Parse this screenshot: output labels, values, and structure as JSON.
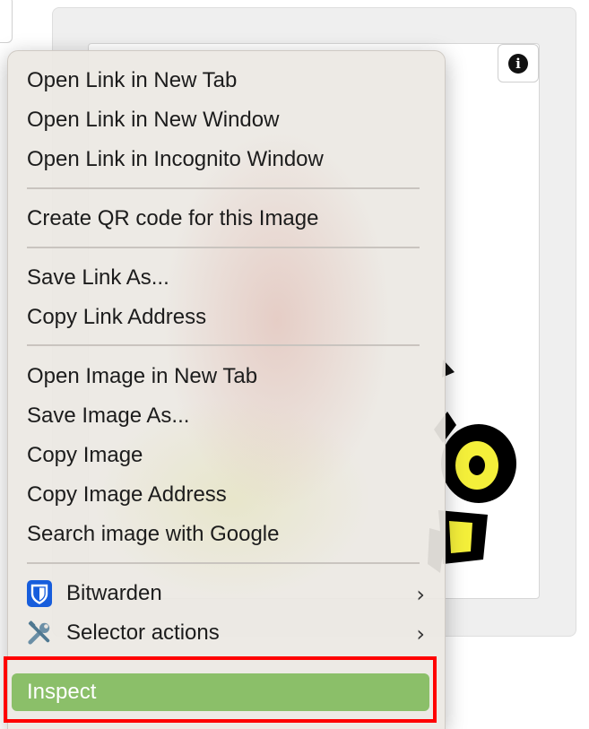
{
  "info_button": {
    "glyph": "i",
    "icon": "info-icon"
  },
  "menu": {
    "groups": [
      [
        "Open Link in New Tab",
        "Open Link in New Window",
        "Open Link in Incognito Window"
      ],
      [
        "Create QR code for this Image"
      ],
      [
        "Save Link As...",
        "Copy Link Address"
      ],
      [
        "Open Image in New Tab",
        "Save Image As...",
        "Copy Image",
        "Copy Image Address",
        "Search image with Google"
      ]
    ],
    "bitwarden": {
      "label": "Bitwarden",
      "icon": "bitwarden-shield-icon",
      "chevron": "›",
      "color": "#175ddc"
    },
    "selector_actions": {
      "label": "Selector actions",
      "icon": "wrench-screwdriver-icon",
      "chevron": "›"
    },
    "inspect": {
      "label": "Inspect",
      "highlight_color": "#8bbf69",
      "annotation_color": "#ff0000"
    }
  }
}
